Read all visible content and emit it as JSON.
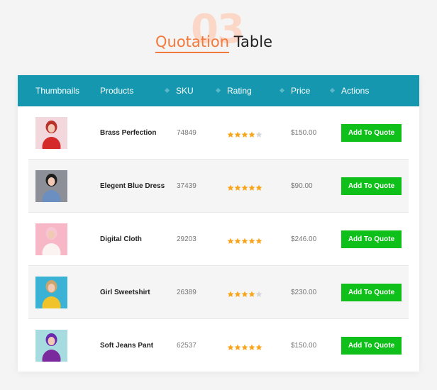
{
  "heading": {
    "number": "03",
    "title_accent": "Quotation",
    "title_main": "Table"
  },
  "colors": {
    "header_bg": "#1597b0",
    "accent": "#f27a3d",
    "button": "#0fbf1a",
    "star_filled": "#f7a51c",
    "star_empty": "#d6d6d6"
  },
  "table": {
    "columns": [
      "Thumbnails",
      "Products",
      "SKU",
      "Rating",
      "Price",
      "Actions"
    ],
    "rows": [
      {
        "product": "Brass Perfection",
        "sku": "74849",
        "rating": 4,
        "price": "$150.00",
        "action": "Add To Quote",
        "thumb_bg": "#f2d7dd",
        "thumb_outfit": "#d42a2a",
        "thumb_hair": "#b8322a"
      },
      {
        "product": "Elegent Blue Dress",
        "sku": "37439",
        "rating": 5,
        "price": "$90.00",
        "action": "Add To Quote",
        "thumb_bg": "#8c8f97",
        "thumb_outfit": "#6a8fc0",
        "thumb_hair": "#1d1d1d"
      },
      {
        "product": "Digital Cloth",
        "sku": "29203",
        "rating": 5,
        "price": "$246.00",
        "action": "Add To Quote",
        "thumb_bg": "#f7b7c7",
        "thumb_outfit": "#fbf2f2",
        "thumb_hair": "#f6c6d3"
      },
      {
        "product": "Girl Sweetshirt",
        "sku": "26389",
        "rating": 4,
        "price": "$230.00",
        "action": "Add To Quote",
        "thumb_bg": "#3ab2d6",
        "thumb_outfit": "#f1c32b",
        "thumb_hair": "#c9a46b"
      },
      {
        "product": "Soft Jeans Pant",
        "sku": "62537",
        "rating": 5,
        "price": "$150.00",
        "action": "Add To Quote",
        "thumb_bg": "#a6dce0",
        "thumb_outfit": "#7b2a9d",
        "thumb_hair": "#6a2ab0"
      }
    ]
  }
}
